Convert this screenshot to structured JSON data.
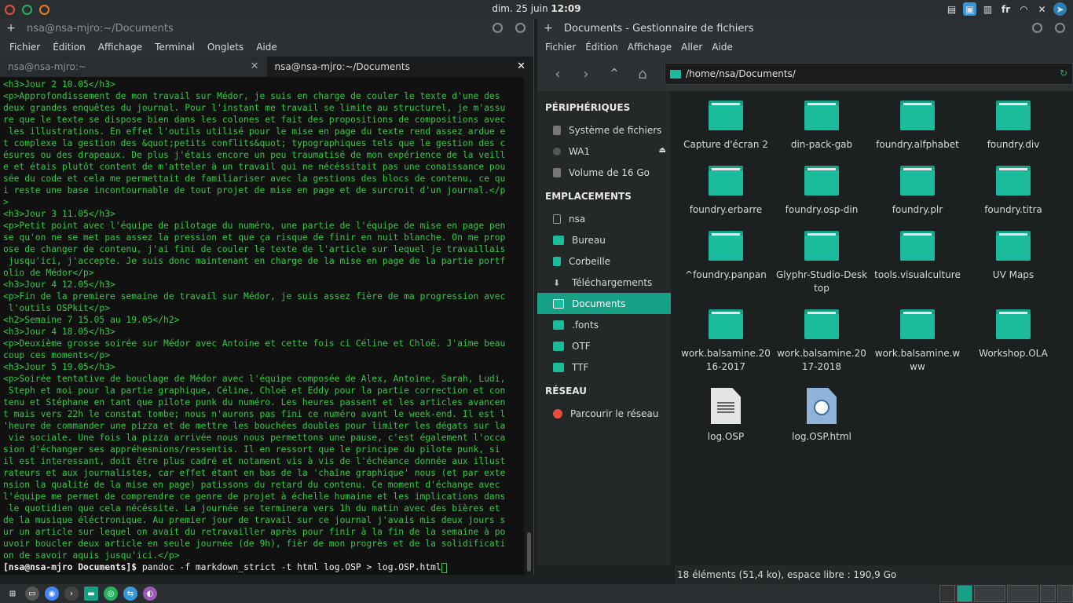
{
  "topbar": {
    "date": "dim. 25 juin",
    "time": "12:09",
    "lang": "fr"
  },
  "terminal": {
    "title": "nsa@nsa-mjro:~/Documents",
    "menu": [
      "Fichier",
      "Édition",
      "Affichage",
      "Terminal",
      "Onglets",
      "Aide"
    ],
    "tabs": [
      "nsa@nsa-mjro:~",
      "nsa@nsa-mjro:~/Documents"
    ],
    "lines": [
      "<h3>Jour 2 10.05</h3>",
      "<p>Approfondissement de mon travail sur Médor, je suis en charge de couler le texte d'une des",
      "deux grandes enquêtes du journal. Pour l'instant me travail se limite au structurel, je m'assu",
      "re que le texte se dispose bien dans les colones et fait des propositions de compositions avec",
      " les illustrations. En effet l'outils utilisé pour le mise en page du texte rend assez ardue e",
      "t complexe la gestion des &quot;petits conflits&quot; typographiques tels que le gestion des c",
      "ésures ou des drapeaux. De plus j'étais encore un peu traumatisé de mon expérience de la veill",
      "e et étais plutôt content de m'atteler à un travail qui ne nécéssitait pas une conaissance pou",
      "sée du code et cela me permettait de familiariser avec la gestions des blocs de contenu, ce qu",
      "i reste une base incontournable de tout projet de mise en page et de surcroit d'un journal.</p",
      ">",
      "<h3>Jour 3 11.05</h3>",
      "<p>Petit point avec l'équipe de pilotage du numéro, une partie de l'équipe de mise en page pen",
      "se qu'on ne se met pas assez la pression et que ça risque de finir en nuit blanche. On me prop",
      "ose de changer de contenu, j'ai fini de couler le texte de l'article sur lequel je travaillais",
      " jusqu'ici, j'accepte. Je suis donc maintenant en charge de la mise en page de la partie portf",
      "olio de Médor</p>",
      "<h3>Jour 4 12.05</h3>",
      "<p>Fin de la premiere semaine de travail sur Médor, je suis assez fière de ma progression avec",
      " l'outils OSPkit</p>",
      "<h2>Semaine 7 15.05 au 19.05</h2>",
      "<h3>Jour 4 18.05</h3>",
      "<p>Deuxième grosse soirée sur Médor avec Antoine et cette fois ci Céline et Chloë. J'aime beau",
      "coup ces moments</p>",
      "<h3>Jour 5 19.05</h3>",
      "<p>Soirée tentative de bouclage de Médor avec l'équipe composée de Alex, Antoine, Sarah, Ludi,",
      " Steph et moi pour la partie graphique, Céline, Chloë et Eddy pour la partie correction et con",
      "tenu et Stéphane en tant que pilote punk du numéro. Les heures passent et les articles avancen",
      "t mais vers 22h le constat tombe; nous n'aurons pas fini ce numéro avant le week-end. Il est l",
      "'heure de commander une pizza et de mettre les bouchées doubles pour limiter les dégats sur la",
      " vie sociale. Une fois la pizza arrivée nous nous permettons une pause, c'est également l'occa",
      "sion d'échanger ses appréhesmions/ressentis. Il en ressort que le principe du pilote punk, si",
      "il est interessant, doit être plus cadré et notament vis à vis de l'échéance donnée aux illust",
      "rateurs et aux journalistes, car effet étant en bas de la 'chaîne graphique' nous (et par exte",
      "nsion la qualité de la mise en page) patissons du retard du contenu. Ce moment d'échange avec",
      "l'équipe me permet de comprendre ce genre de projet à échelle humaine et les implications dans",
      " le quotidien que cela nécéssite. La journée se terminera vers 1h du matin avec des bières et",
      "de la musique éléctronique. Au premier jour de travail sur ce journal j'avais mis deux jours s",
      "ur un article sur lequel on avait du retravailler après pour finir à la fin de la semaine à po",
      "uvoir boucler deux article en seule journée (de 9h), fièr de mon progrès et de la solidificati",
      "on de savoir aquis jusqu'ici.</p>"
    ],
    "prompt_user": "[nsa@nsa-mjro Documents]$",
    "command": " pandoc -f markdown_strict -t html log.OSP > log.OSP.html"
  },
  "filemanager": {
    "title": "Documents - Gestionnaire de fichiers",
    "menu": [
      "Fichier",
      "Édition",
      "Affichage",
      "Aller",
      "Aide"
    ],
    "path": "/home/nsa/Documents/",
    "sections": {
      "devices": "PÉRIPHÉRIQUES",
      "places": "EMPLACEMENTS",
      "network": "RÉSEAU"
    },
    "devices": [
      "Système de fichiers",
      "WA1",
      "Volume de 16 Go"
    ],
    "places": [
      "nsa",
      "Bureau",
      "Corbeille",
      "Téléchargements",
      "Documents",
      ".fonts",
      "OTF",
      "TTF"
    ],
    "network": [
      "Parcourir le réseau"
    ],
    "items": [
      "Capture d'écran 2",
      "din-pack-gab",
      "foundry.alfphabet",
      "foundry.div",
      "foundry.erbarre",
      "foundry.osp-din",
      "foundry.plr",
      "foundry.titra",
      "^foundry.panpan",
      "Glyphr-Studio-Desktop",
      "tools.visualculture",
      "UV Maps",
      "work.balsamine.2016-2017",
      "work.balsamine.2017-2018",
      "work.balsamine.www",
      "Workshop.OLA",
      "log.OSP",
      "log.OSP.html"
    ],
    "status": "18 éléments (51,4 ko), espace libre : 190,9 Go"
  },
  "colors": {
    "accent": "#1abc9c",
    "selected": "#16a085",
    "terminal_text": "#2ecc40"
  }
}
